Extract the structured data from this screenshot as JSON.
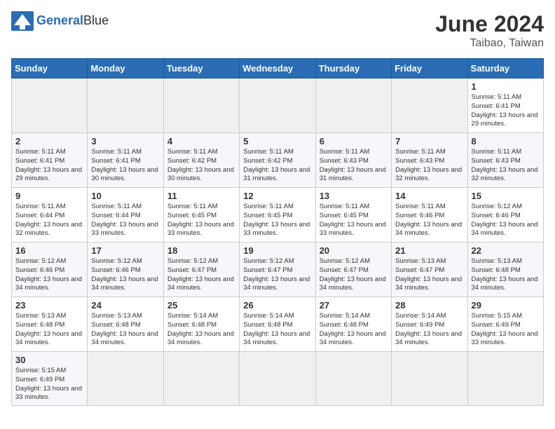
{
  "header": {
    "logo_general": "General",
    "logo_blue": "Blue",
    "month_year": "June 2024",
    "location": "Taibao, Taiwan"
  },
  "weekdays": [
    "Sunday",
    "Monday",
    "Tuesday",
    "Wednesday",
    "Thursday",
    "Friday",
    "Saturday"
  ],
  "weeks": [
    [
      {
        "day": "",
        "sunrise": "",
        "sunset": "",
        "daylight": ""
      },
      {
        "day": "",
        "sunrise": "",
        "sunset": "",
        "daylight": ""
      },
      {
        "day": "",
        "sunrise": "",
        "sunset": "",
        "daylight": ""
      },
      {
        "day": "",
        "sunrise": "",
        "sunset": "",
        "daylight": ""
      },
      {
        "day": "",
        "sunrise": "",
        "sunset": "",
        "daylight": ""
      },
      {
        "day": "",
        "sunrise": "",
        "sunset": "",
        "daylight": ""
      },
      {
        "day": "1",
        "sunrise": "Sunrise: 5:11 AM",
        "sunset": "Sunset: 6:41 PM",
        "daylight": "Daylight: 13 hours and 29 minutes."
      }
    ],
    [
      {
        "day": "2",
        "sunrise": "Sunrise: 5:11 AM",
        "sunset": "Sunset: 6:41 PM",
        "daylight": "Daylight: 13 hours and 29 minutes."
      },
      {
        "day": "3",
        "sunrise": "Sunrise: 5:11 AM",
        "sunset": "Sunset: 6:41 PM",
        "daylight": "Daylight: 13 hours and 30 minutes."
      },
      {
        "day": "4",
        "sunrise": "Sunrise: 5:11 AM",
        "sunset": "Sunset: 6:42 PM",
        "daylight": "Daylight: 13 hours and 30 minutes."
      },
      {
        "day": "5",
        "sunrise": "Sunrise: 5:11 AM",
        "sunset": "Sunset: 6:42 PM",
        "daylight": "Daylight: 13 hours and 31 minutes."
      },
      {
        "day": "6",
        "sunrise": "Sunrise: 5:11 AM",
        "sunset": "Sunset: 6:43 PM",
        "daylight": "Daylight: 13 hours and 31 minutes."
      },
      {
        "day": "7",
        "sunrise": "Sunrise: 5:11 AM",
        "sunset": "Sunset: 6:43 PM",
        "daylight": "Daylight: 13 hours and 32 minutes."
      },
      {
        "day": "8",
        "sunrise": "Sunrise: 5:11 AM",
        "sunset": "Sunset: 6:43 PM",
        "daylight": "Daylight: 13 hours and 32 minutes."
      }
    ],
    [
      {
        "day": "9",
        "sunrise": "Sunrise: 5:11 AM",
        "sunset": "Sunset: 6:44 PM",
        "daylight": "Daylight: 13 hours and 32 minutes."
      },
      {
        "day": "10",
        "sunrise": "Sunrise: 5:11 AM",
        "sunset": "Sunset: 6:44 PM",
        "daylight": "Daylight: 13 hours and 33 minutes."
      },
      {
        "day": "11",
        "sunrise": "Sunrise: 5:11 AM",
        "sunset": "Sunset: 6:45 PM",
        "daylight": "Daylight: 13 hours and 33 minutes."
      },
      {
        "day": "12",
        "sunrise": "Sunrise: 5:11 AM",
        "sunset": "Sunset: 6:45 PM",
        "daylight": "Daylight: 13 hours and 33 minutes."
      },
      {
        "day": "13",
        "sunrise": "Sunrise: 5:11 AM",
        "sunset": "Sunset: 6:45 PM",
        "daylight": "Daylight: 13 hours and 33 minutes."
      },
      {
        "day": "14",
        "sunrise": "Sunrise: 5:11 AM",
        "sunset": "Sunset: 6:46 PM",
        "daylight": "Daylight: 13 hours and 34 minutes."
      },
      {
        "day": "15",
        "sunrise": "Sunrise: 5:12 AM",
        "sunset": "Sunset: 6:46 PM",
        "daylight": "Daylight: 13 hours and 34 minutes."
      }
    ],
    [
      {
        "day": "16",
        "sunrise": "Sunrise: 5:12 AM",
        "sunset": "Sunset: 6:46 PM",
        "daylight": "Daylight: 13 hours and 34 minutes."
      },
      {
        "day": "17",
        "sunrise": "Sunrise: 5:12 AM",
        "sunset": "Sunset: 6:46 PM",
        "daylight": "Daylight: 13 hours and 34 minutes."
      },
      {
        "day": "18",
        "sunrise": "Sunrise: 5:12 AM",
        "sunset": "Sunset: 6:47 PM",
        "daylight": "Daylight: 13 hours and 34 minutes."
      },
      {
        "day": "19",
        "sunrise": "Sunrise: 5:12 AM",
        "sunset": "Sunset: 6:47 PM",
        "daylight": "Daylight: 13 hours and 34 minutes."
      },
      {
        "day": "20",
        "sunrise": "Sunrise: 5:12 AM",
        "sunset": "Sunset: 6:47 PM",
        "daylight": "Daylight: 13 hours and 34 minutes."
      },
      {
        "day": "21",
        "sunrise": "Sunrise: 5:13 AM",
        "sunset": "Sunset: 6:47 PM",
        "daylight": "Daylight: 13 hours and 34 minutes."
      },
      {
        "day": "22",
        "sunrise": "Sunrise: 5:13 AM",
        "sunset": "Sunset: 6:48 PM",
        "daylight": "Daylight: 13 hours and 34 minutes."
      }
    ],
    [
      {
        "day": "23",
        "sunrise": "Sunrise: 5:13 AM",
        "sunset": "Sunset: 6:48 PM",
        "daylight": "Daylight: 13 hours and 34 minutes."
      },
      {
        "day": "24",
        "sunrise": "Sunrise: 5:13 AM",
        "sunset": "Sunset: 6:48 PM",
        "daylight": "Daylight: 13 hours and 34 minutes."
      },
      {
        "day": "25",
        "sunrise": "Sunrise: 5:14 AM",
        "sunset": "Sunset: 6:48 PM",
        "daylight": "Daylight: 13 hours and 34 minutes."
      },
      {
        "day": "26",
        "sunrise": "Sunrise: 5:14 AM",
        "sunset": "Sunset: 6:48 PM",
        "daylight": "Daylight: 13 hours and 34 minutes."
      },
      {
        "day": "27",
        "sunrise": "Sunrise: 5:14 AM",
        "sunset": "Sunset: 6:48 PM",
        "daylight": "Daylight: 13 hours and 34 minutes."
      },
      {
        "day": "28",
        "sunrise": "Sunrise: 5:14 AM",
        "sunset": "Sunset: 6:49 PM",
        "daylight": "Daylight: 13 hours and 34 minutes."
      },
      {
        "day": "29",
        "sunrise": "Sunrise: 5:15 AM",
        "sunset": "Sunset: 6:49 PM",
        "daylight": "Daylight: 13 hours and 33 minutes."
      }
    ],
    [
      {
        "day": "30",
        "sunrise": "Sunrise: 5:15 AM",
        "sunset": "Sunset: 6:49 PM",
        "daylight": "Daylight: 13 hours and 33 minutes."
      },
      {
        "day": "",
        "sunrise": "",
        "sunset": "",
        "daylight": ""
      },
      {
        "day": "",
        "sunrise": "",
        "sunset": "",
        "daylight": ""
      },
      {
        "day": "",
        "sunrise": "",
        "sunset": "",
        "daylight": ""
      },
      {
        "day": "",
        "sunrise": "",
        "sunset": "",
        "daylight": ""
      },
      {
        "day": "",
        "sunrise": "",
        "sunset": "",
        "daylight": ""
      },
      {
        "day": "",
        "sunrise": "",
        "sunset": "",
        "daylight": ""
      }
    ]
  ]
}
